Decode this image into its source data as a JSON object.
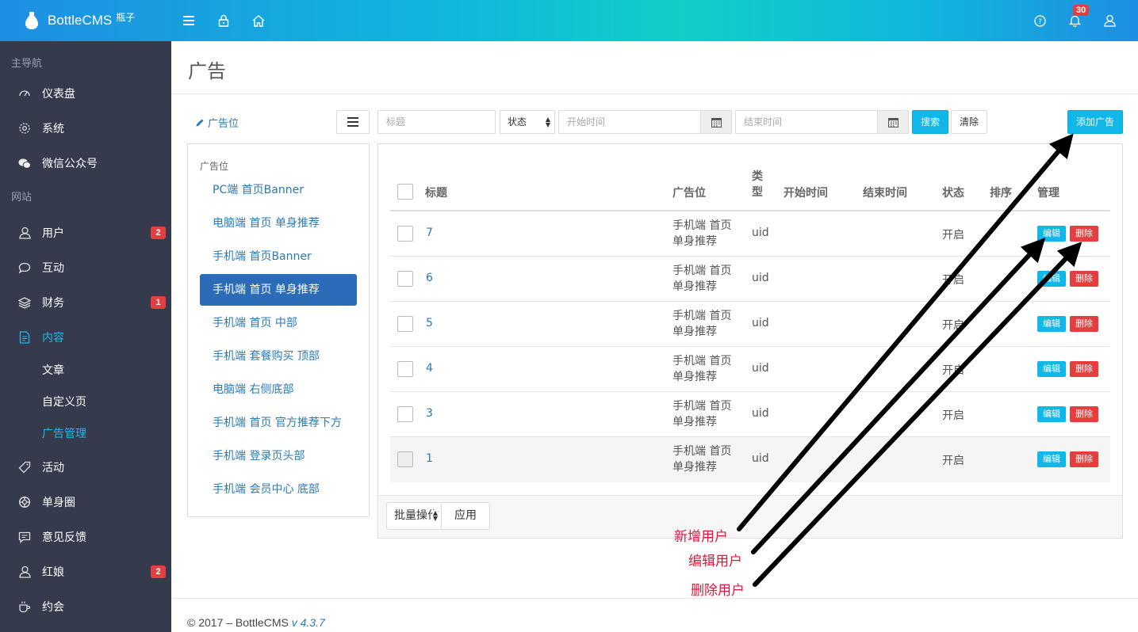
{
  "brand": {
    "name": "BottleCMS",
    "sub": "瓶子"
  },
  "topbar": {
    "notification_count": "30"
  },
  "sidebar": {
    "section_main": "主导航",
    "main_items": [
      {
        "label": "仪表盘",
        "icon": "dashboard-icon"
      },
      {
        "label": "系统",
        "icon": "gear-icon"
      },
      {
        "label": "微信公众号",
        "icon": "wechat-icon"
      }
    ],
    "section_site": "网站",
    "site_items": [
      {
        "label": "用户",
        "icon": "user-icon",
        "badge": "2"
      },
      {
        "label": "互动",
        "icon": "chat-icon"
      },
      {
        "label": "财务",
        "icon": "layers-icon",
        "badge": "1"
      },
      {
        "label": "内容",
        "icon": "document-icon",
        "active": true
      }
    ],
    "sub_items": [
      {
        "label": "文章"
      },
      {
        "label": "自定义页"
      },
      {
        "label": "广告管理",
        "active": true
      }
    ],
    "more_items": [
      {
        "label": "活动",
        "icon": "tag-icon"
      },
      {
        "label": "单身圈",
        "icon": "lifebuoy-icon"
      },
      {
        "label": "意见反馈",
        "icon": "feedback-icon"
      },
      {
        "label": "红娘",
        "icon": "matchmaker-icon",
        "badge": "2"
      },
      {
        "label": "约会",
        "icon": "coffee-icon"
      }
    ]
  },
  "page": {
    "title": "广告"
  },
  "left_panel": {
    "link_label": "广告位",
    "header": "广告位",
    "items": [
      "PC端 首页Banner",
      "电脑端 首页 单身推荐",
      "手机端 首页Banner",
      "手机端 首页 单身推荐",
      "手机端 首页 中部",
      "手机端 套餐购买 顶部",
      "电脑端 右侧底部",
      "手机端 首页 官方推荐下方",
      "手机端 登录页头部",
      "手机端 会员中心 底部"
    ],
    "active_index": 3
  },
  "filters": {
    "title_placeholder": "标题",
    "status_label": "状态",
    "start_placeholder": "开始时间",
    "end_placeholder": "结束时间",
    "search_label": "搜索",
    "clear_label": "清除",
    "add_label": "添加广告"
  },
  "table": {
    "columns": [
      "标题",
      "广告位",
      "类型",
      "开始时间",
      "结束时间",
      "状态",
      "排序",
      "管理"
    ],
    "rows": [
      {
        "title": "7",
        "position_line1": "手机端 首页",
        "position_line2": "单身推荐",
        "type": "uid",
        "status": "开启"
      },
      {
        "title": "6",
        "position_line1": "手机端 首页",
        "position_line2": "单身推荐",
        "type": "uid",
        "status": "开启"
      },
      {
        "title": "5",
        "position_line1": "手机端 首页",
        "position_line2": "单身推荐",
        "type": "uid",
        "status": "开启"
      },
      {
        "title": "4",
        "position_line1": "手机端 首页",
        "position_line2": "单身推荐",
        "type": "uid",
        "status": "开启"
      },
      {
        "title": "3",
        "position_line1": "手机端 首页",
        "position_line2": "单身推荐",
        "type": "uid",
        "status": "开启"
      },
      {
        "title": "1",
        "position_line1": "手机端 首页",
        "position_line2": "单身推荐",
        "type": "uid",
        "status": "开启"
      }
    ],
    "edit_label": "编辑",
    "delete_label": "删除"
  },
  "batch": {
    "select_label": "批量操作",
    "apply_label": "应用"
  },
  "footer": {
    "copyright": "© 2017 – BottleCMS ",
    "version": "v 4.3.7"
  },
  "annotations": {
    "add_user": "新增用户",
    "edit_user": "编辑用户",
    "delete_user": "删除用户"
  }
}
